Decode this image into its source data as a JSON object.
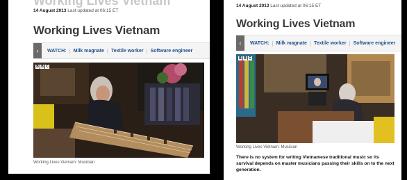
{
  "left": {
    "ghost_headline": "Working Lives Vietnam",
    "date": "14 August 2013",
    "updated": "Last updated at 06:15 ET",
    "headline": "Working Lives Vietnam",
    "watch_label": "WATCH:",
    "watch_items": [
      "Milk magnate",
      "Textile worker",
      "Software engineer"
    ],
    "share_label": "Pr",
    "bbc_letters": [
      "B",
      "B",
      "C"
    ],
    "caption": "Working Lives Vietnam: Musician"
  },
  "right": {
    "date": "14 August 2013",
    "updated": "Last updated at 06:15 ET",
    "headline": "Working Lives Vietnam",
    "watch_label": "WATCH:",
    "watch_items": [
      "Milk magnate",
      "Textile worker",
      "Software engineer"
    ],
    "bbc_letters": [
      "B",
      "B",
      "C"
    ],
    "caption": "Working Lives Vietnam: Musician",
    "summary": "There is no system for writing Vietnamese traditional music so its survival depends on master musicians passing their skills on to the next generation."
  },
  "icons": {
    "prev": "chevron-left-icon"
  },
  "colors": {
    "link": "#1f4f8f",
    "headline": "#3a3a3a",
    "background": "#000000"
  }
}
